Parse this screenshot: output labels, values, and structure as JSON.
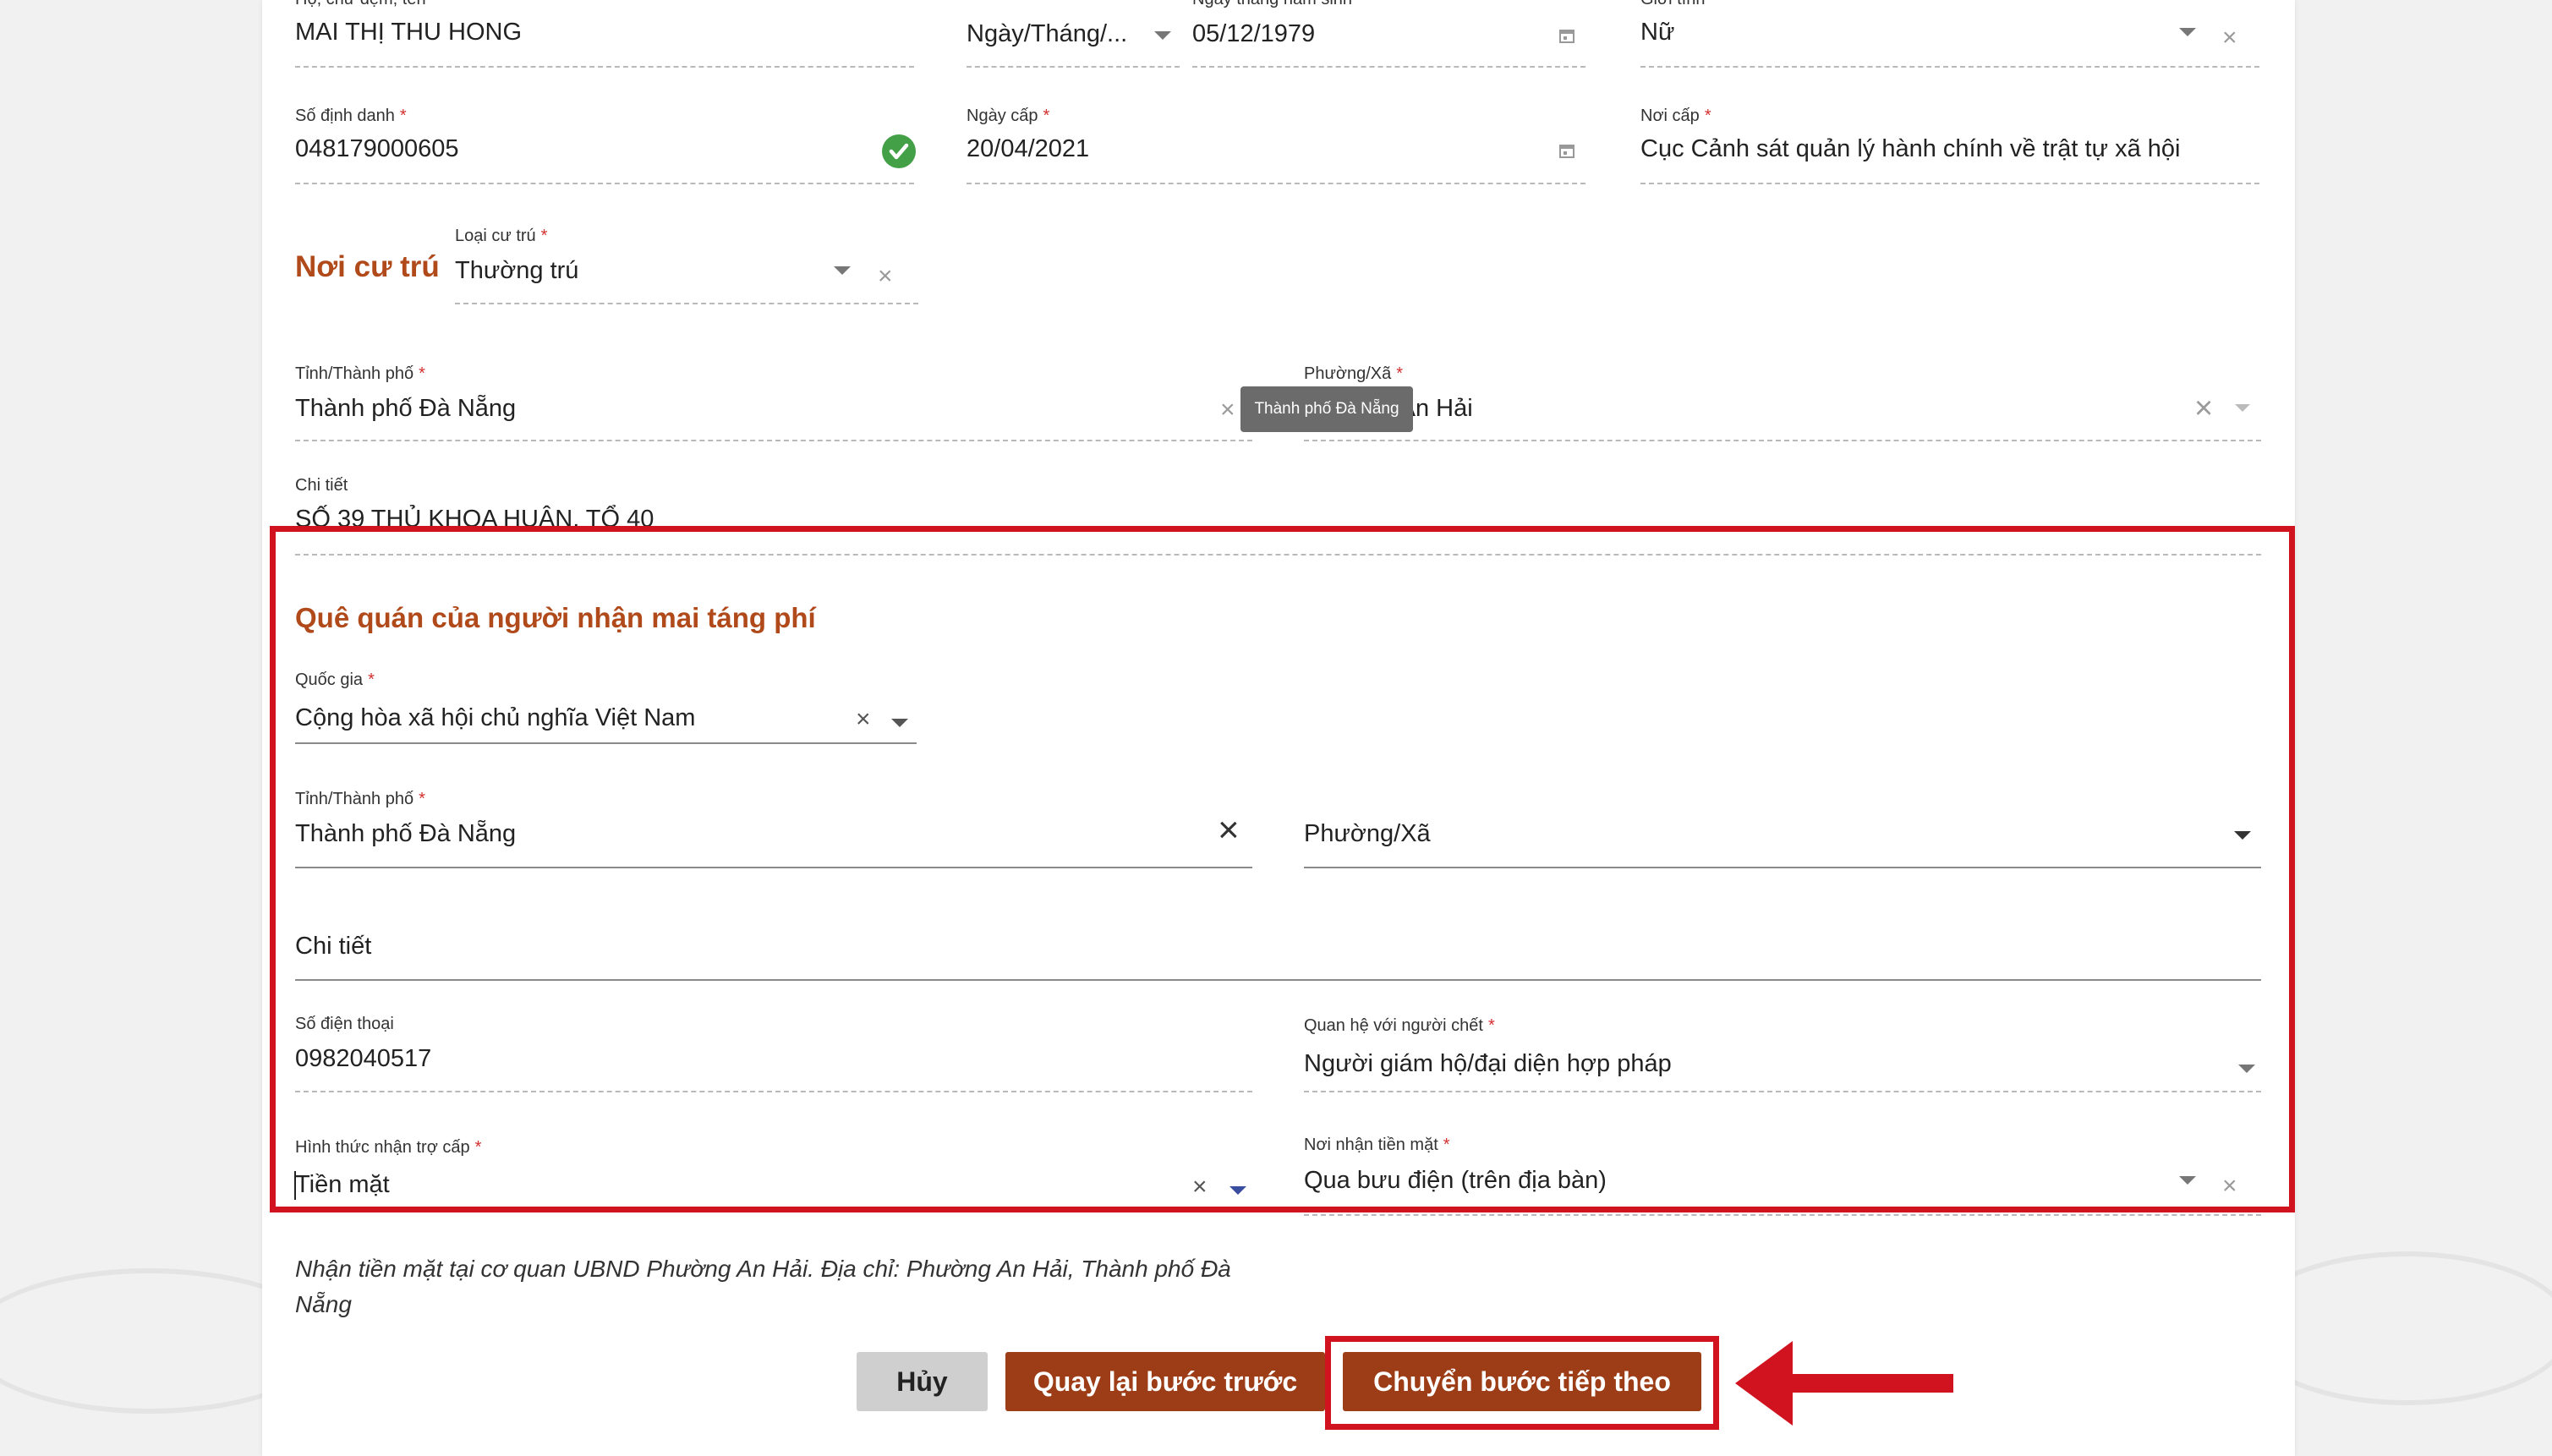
{
  "personal": {
    "name_label": "Họ, chữ đệm, tên",
    "name_value": "MAI THỊ THU HONG",
    "dob_format_value": "Ngày/Tháng/...",
    "dob_label": "Ngày tháng năm sinh",
    "dob_value": "05/12/1979",
    "gender_label": "Giới tính",
    "gender_value": "Nữ",
    "id_label": "Số định danh",
    "id_value": "048179000605",
    "issue_date_label": "Ngày cấp",
    "issue_date_value": "20/04/2021",
    "issue_place_label": "Nơi cấp",
    "issue_place_value": "Cục Cảnh sát quản lý hành chính về trật tự xã hội"
  },
  "residence": {
    "title": "Nơi cư trú",
    "type_label": "Loại cư trú",
    "type_value": "Thường trú",
    "province_label": "Tỉnh/Thành phố",
    "province_value": "Thành phố Đà Nẵng",
    "ward_label": "Phường/Xã",
    "ward_value": "Phường An Hải",
    "tooltip": "Thành phố Đà Nẵng",
    "detail_label": "Chi tiết",
    "detail_value": "SỐ 39 THỦ KHOA HUÂN, TỔ 40"
  },
  "hometown": {
    "title": "Quê quán của người nhận mai táng phí",
    "country_label": "Quốc gia",
    "country_value": "Cộng hòa xã hội chủ nghĩa Việt Nam",
    "province_label": "Tỉnh/Thành phố",
    "province_value": "Thành phố Đà Nẵng",
    "ward_placeholder": "Phường/Xã",
    "detail_placeholder": "Chi tiết",
    "phone_label": "Số điện thoại",
    "phone_value": "0982040517",
    "relation_label": "Quan hệ với người chết",
    "relation_value": "Người giám hộ/đại diện hợp pháp",
    "method_label": "Hình thức nhận trợ cấp",
    "method_value": "Tiền mặt",
    "receive_place_label": "Nơi nhận tiền mặt",
    "receive_place_value": "Qua bưu điện (trên địa bàn)"
  },
  "note": "Nhận tiền mặt tại cơ quan UBND Phường An Hải. Địa chỉ: Phường An Hải, Thành phố Đà Nẵng",
  "buttons": {
    "cancel": "Hủy",
    "back": "Quay lại bước trước",
    "next": "Chuyển bước tiếp theo"
  },
  "colors": {
    "accent": "#b14a1b",
    "button_primary": "#9c3d17",
    "highlight": "#d0131f"
  }
}
